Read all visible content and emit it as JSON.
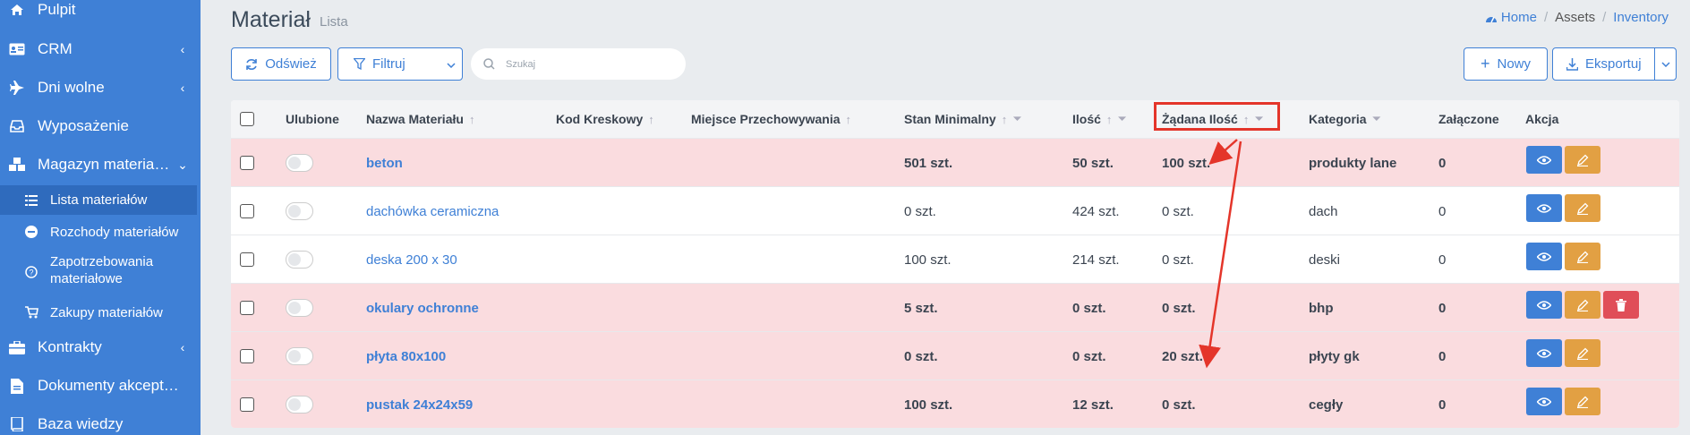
{
  "sidebar": {
    "items": [
      {
        "label": "Pulpit",
        "icon": "home-icon"
      },
      {
        "label": "CRM",
        "icon": "contact-card-icon"
      },
      {
        "label": "Dni wolne",
        "icon": "plane-icon"
      },
      {
        "label": "Wyposażenie",
        "icon": "inbox-icon"
      },
      {
        "label": "Magazyn materiał…",
        "icon": "cubes-icon"
      },
      {
        "label": "Kontrakty",
        "icon": "briefcase-icon"
      },
      {
        "label": "Dokumenty akcept…",
        "icon": "document-icon"
      },
      {
        "label": "Baza wiedzy",
        "icon": "book-icon"
      }
    ],
    "subitems": [
      {
        "label": "Lista materiałów",
        "icon": "list-icon"
      },
      {
        "label": "Rozchody materiałów",
        "icon": "minus-circle-icon"
      },
      {
        "label": "Zapotrzebowania",
        "label2": "materiałowe",
        "icon": "question-circle-icon"
      },
      {
        "label": "Zakupy materiałów",
        "icon": "cart-icon"
      }
    ]
  },
  "header": {
    "title": "Materiał",
    "subtitle": "Lista",
    "breadcrumb": {
      "home": "Home",
      "assets": "Assets",
      "inventory": "Inventory"
    }
  },
  "toolbar": {
    "refresh": "Odśwież",
    "filter": "Filtruj",
    "search_placeholder": "Szukaj",
    "new": "Nowy",
    "export": "Eksportuj"
  },
  "table": {
    "headers": {
      "favorite": "Ulubione",
      "name": "Nazwa Materiału",
      "barcode": "Kod Kreskowy",
      "location": "Miejsce Przechowywania",
      "min_stock": "Stan Minimalny",
      "qty": "Ilość",
      "requested": "Żądana Ilość",
      "category": "Kategoria",
      "attached": "Załączone",
      "action": "Akcja"
    },
    "rows": [
      {
        "name": "beton",
        "min": "501 szt.",
        "qty": "50 szt.",
        "req": "100 szt.",
        "cat": "produkty lane",
        "att": "0"
      },
      {
        "name": "dachówka ceramiczna",
        "min": "0 szt.",
        "qty": "424 szt.",
        "req": "0 szt.",
        "cat": "dach",
        "att": "0"
      },
      {
        "name": "deska 200 x 30",
        "min": "100 szt.",
        "qty": "214 szt.",
        "req": "0 szt.",
        "cat": "deski",
        "att": "0"
      },
      {
        "name": "okulary ochronne",
        "min": "5 szt.",
        "qty": "0 szt.",
        "req": "0 szt.",
        "cat": "bhp",
        "att": "0"
      },
      {
        "name": "płyta 80x100",
        "min": "0 szt.",
        "qty": "0 szt.",
        "req": "20 szt.",
        "cat": "płyty gk",
        "att": "0"
      },
      {
        "name": "pustak 24x24x59",
        "min": "100 szt.",
        "qty": "12 szt.",
        "req": "0 szt.",
        "cat": "cegły",
        "att": "0"
      }
    ]
  },
  "colors": {
    "primary": "#3f80d6",
    "alert_row": "#fadcdf",
    "edit": "#e2a043",
    "delete": "#e04e58",
    "annotation": "#e4352a"
  }
}
